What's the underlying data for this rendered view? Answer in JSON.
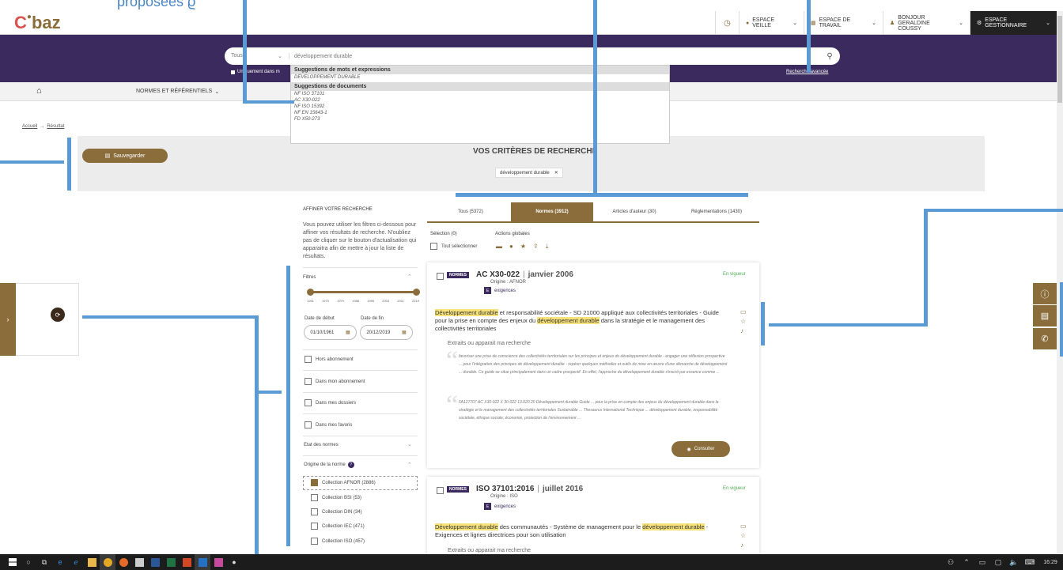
{
  "annotation": {
    "text": "proposées ϱ"
  },
  "topbar": {
    "logo_a": "C",
    "logo_b": "●",
    "logo_c": "baz",
    "veille": "ESPACE VEILLE",
    "travail": "ESPACE DE TRAVAIL",
    "bonjour": "BONJOUR",
    "user": "GERALDINE COUSSY",
    "gestion": "ESPACE GESTIONNAIRE"
  },
  "search": {
    "scope": "Tous",
    "query": "développement durable",
    "only_label": "Uniquement dans m",
    "advanced": "Recherche avancée"
  },
  "menubar": {
    "normes": "NORMES ET RÉFÉRENTIELS"
  },
  "dropdown": {
    "words_head": "Suggestions de mots et expressions",
    "word": "DÉVELOPPEMENT DURABLE",
    "docs_head": "Suggestions de documents",
    "docs": [
      "NF ISO 37101",
      "AC X30-022",
      "NF ISO 15392",
      "NF EN 15643-1",
      "FD X50-273"
    ]
  },
  "breadcrumb": {
    "home": "Accueil",
    "arrow": "→",
    "current": "Résultat"
  },
  "criteria": {
    "save": "Sauvegarder",
    "title": "VOS CRITÈRES DE RECHERCHE",
    "chip": "développement durable",
    "chip_x": "✕"
  },
  "filters": {
    "heading": "AFFINER VOTRE RECHERCHE",
    "intro": "Vous pouvez utiliser les filtres ci-dessous pour affiner vos résultats de recherche. N'oubliez pas de cliquer sur le bouton d'actualisation qui apparaitra afin de mettre à jour la liste de résultats.",
    "filtres": "Filtres",
    "years": [
      "1961",
      "1970",
      "1979",
      "1988",
      "1996",
      "2003",
      "2011",
      "2019"
    ],
    "date_debut_label": "Date de début",
    "date_fin_label": "Date de fin",
    "date_debut": "01/10/1961",
    "date_fin": "20/12/2019",
    "checks": [
      "Hors abonnement",
      "Dans mon abonnement",
      "Dans mes dossiers",
      "Dans mes favoris"
    ],
    "etat": "Etat des normes",
    "origine": "Origine de la norme",
    "collections": [
      {
        "label": "Collection AFNOR (2886)",
        "checked": true
      },
      {
        "label": "Collection BSI (53)",
        "checked": false
      },
      {
        "label": "Collection DIN (34)",
        "checked": false
      },
      {
        "label": "Collection IEC (471)",
        "checked": false
      },
      {
        "label": "Collection ISO (457)",
        "checked": false
      }
    ]
  },
  "tabs": [
    {
      "label": "Tous (5372)"
    },
    {
      "label": "Normes (3912)"
    },
    {
      "label": "Articles d'auteur (30)"
    },
    {
      "label": "Réglementations (1430)"
    }
  ],
  "actions": {
    "selection": "Sélection (0)",
    "globales": "Actions globales",
    "select_all": "Tout sélectionner"
  },
  "results": [
    {
      "badge": "NORMES",
      "ref": "AC X30-022",
      "date": "janvier 2006",
      "origin": "Origine : AFNOR",
      "tag_letter": "E",
      "tag": "exigences",
      "status": "En vigueur",
      "title_pre": "Développement durable",
      "title_mid": " et responsabilité sociétale - SD 21000 appliqué aux collectivités territoriales - Guide pour la prise en compte des enjeux du ",
      "title_hl2": "développement durable",
      "title_post": " dans la stratégie et le management des collectivités territoriales",
      "extracts": "Extraits ou apparait ma recherche",
      "ex1": "favoriser une prise de conscience des collectivités territoriales sur les principes et enjeux du développement durable - engager une réflexion prospective ... pour l'intégration des principes de développement durable - repérer quelques méthodes et outils de mise en œuvre d'une démarche de développement ... durable. Ce guide se situe principalement dans un cadre prospectif. En effet, l'approche du développement durable s'inscrit par essence comme ...",
      "ex2": "FA127707 AC X30-022 X 30-022 13.020.20 Développement durable Guide ... pour la prise en compte des enjeux du développement durable dans la stratégie et le management des collectivités territoriales Sustainable ... Thesaurus International Technique ... développement durable, responsabilité sociétale, éthique sociale, économie, protection de l'environnement ...",
      "consult": "Consulter"
    },
    {
      "badge": "NORMES",
      "ref": "ISO 37101:2016",
      "date": "juillet 2016",
      "origin": "Origine : ISO",
      "tag_letter": "E",
      "tag": "exigences",
      "status": "En vigueur",
      "title_pre": "Développement durable",
      "title_mid": " des communautés - Système de management pour le ",
      "title_hl2": "développement durable",
      "title_post": " - Exigences et lignes directrices pour son utilisation",
      "extracts": "Extraits ou apparait ma recherche"
    }
  ],
  "taskbar": {
    "time": "16:29"
  },
  "colors": {
    "brand": "#8a6d3b",
    "purple": "#3b2a5e",
    "annotation": "#5b9bd5",
    "highlight": "#f7e27a"
  }
}
